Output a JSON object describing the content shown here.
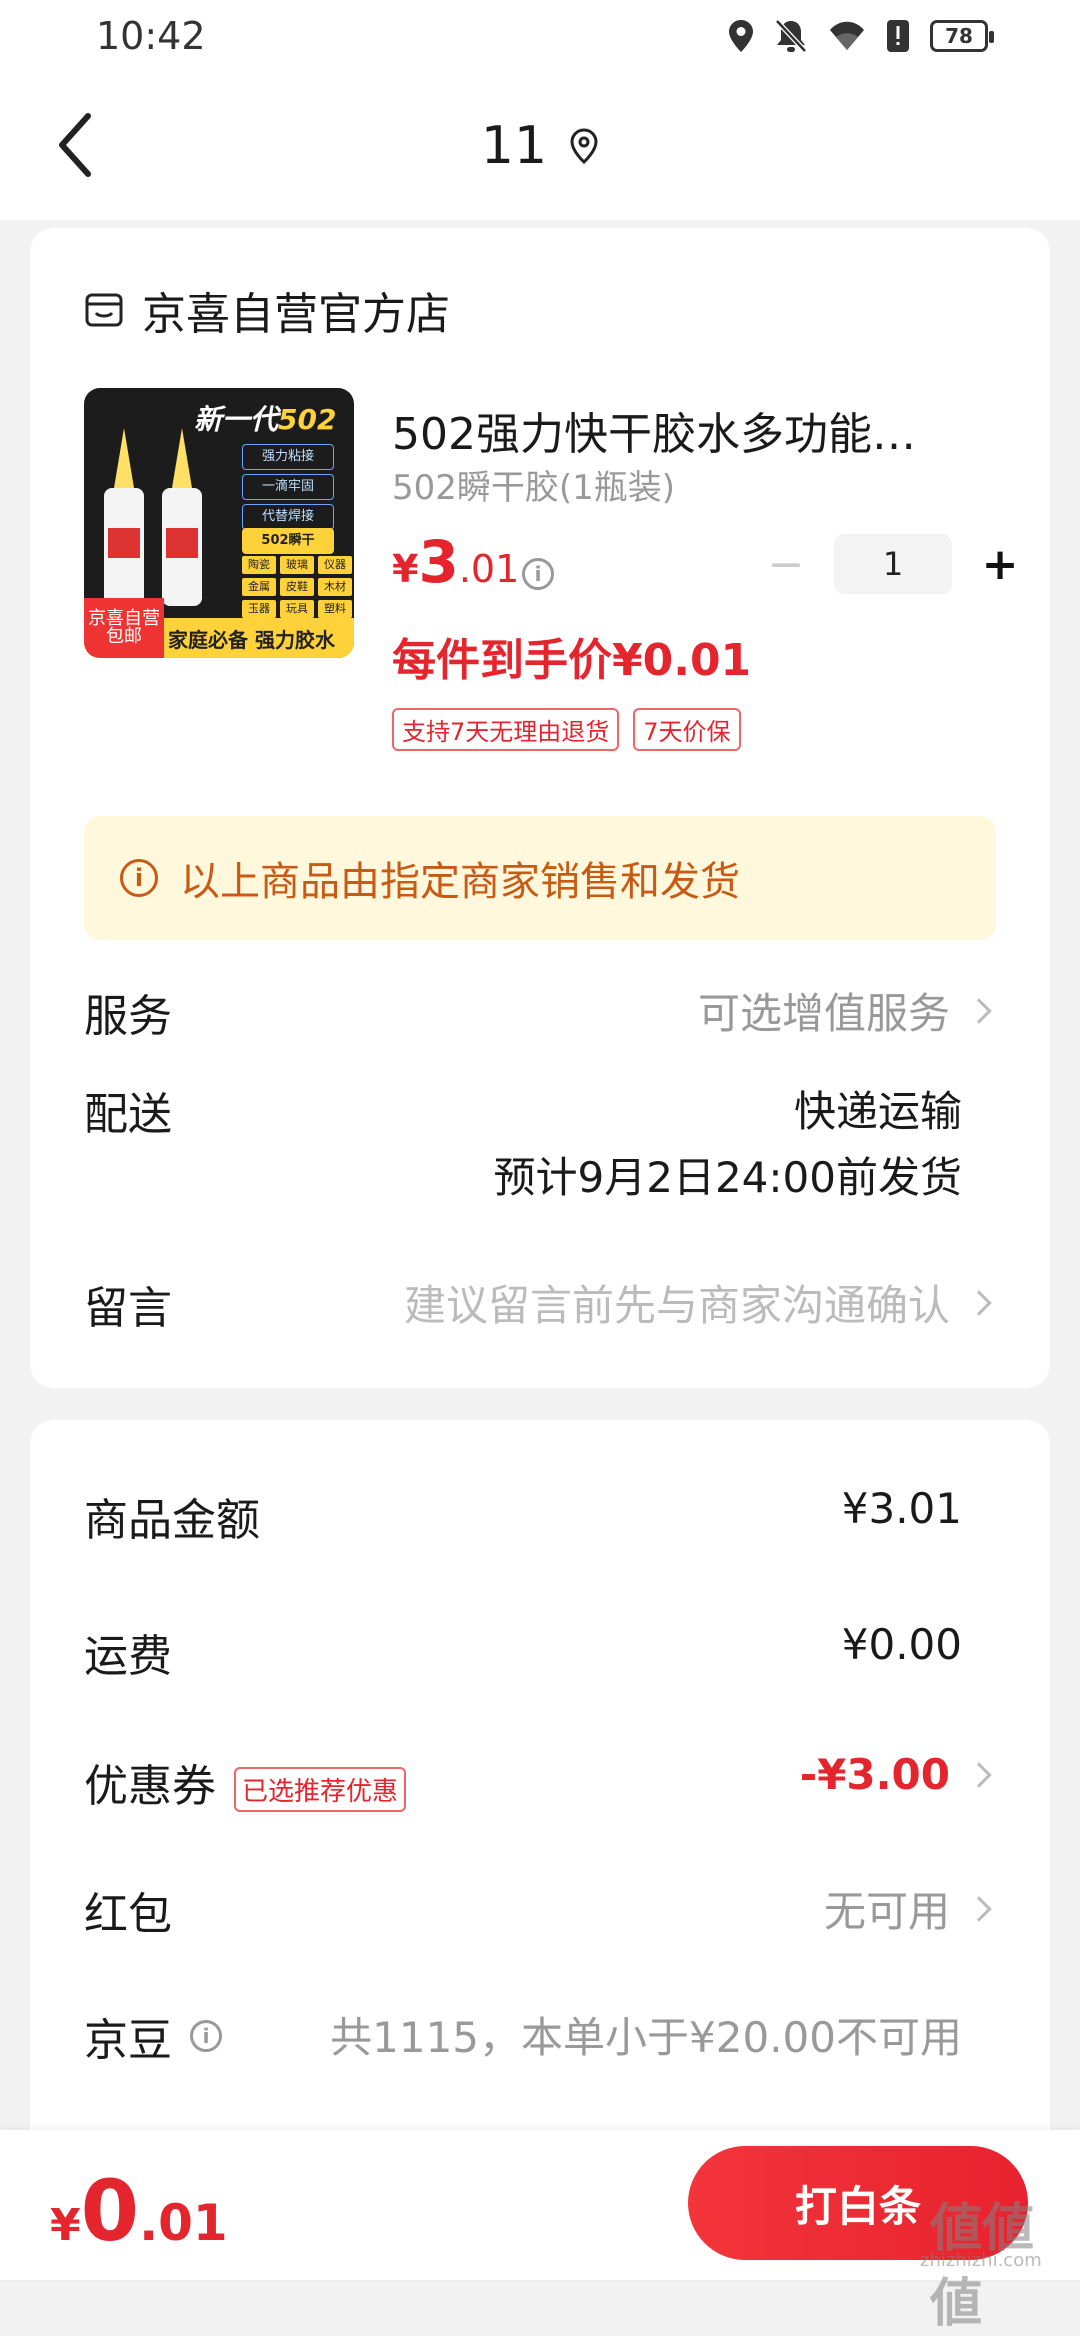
{
  "status": {
    "time": "10:42",
    "battery": "78"
  },
  "nav": {
    "title": "11"
  },
  "shop": {
    "name": "京喜自营官方店"
  },
  "product": {
    "image": {
      "top_text_a": "新一代",
      "top_text_b": "502",
      "features": [
        "强力粘接",
        "一滴牢固",
        "代替焊接"
      ],
      "highlight": "502瞬干",
      "grid": [
        "陶瓷",
        "玻璃",
        "仪器",
        "金属",
        "皮鞋",
        "木材",
        "玉器",
        "玩具",
        "塑料"
      ],
      "tag_a": "京喜自营",
      "tag_b": "包邮",
      "slogan": "家庭必备 强力胶水"
    },
    "title": "502强力快干胶水多功能…",
    "spec": "502瞬干胶(1瓶装)",
    "price_currency": "¥",
    "price_int": "3",
    "price_dec": ".01",
    "quantity": "1",
    "final_price": "每件到手价¥0.01",
    "badges": [
      "支持7天无理由退货",
      "7天价保"
    ]
  },
  "notice": {
    "text": "以上商品由指定商家销售和发货"
  },
  "rows": {
    "service": {
      "label": "服务",
      "value": "可选增值服务"
    },
    "delivery": {
      "label": "配送",
      "method": "快递运输",
      "eta": "预计9月2日24:00前发货"
    },
    "message": {
      "label": "留言",
      "placeholder": "建议留言前先与商家沟通确认"
    }
  },
  "summary": {
    "goods": {
      "label": "商品金额",
      "value": "¥3.01"
    },
    "shipping": {
      "label": "运费",
      "value": "¥0.00"
    },
    "coupon": {
      "label": "优惠券",
      "tag": "已选推荐优惠",
      "value": "-¥3.00"
    },
    "redpacket": {
      "label": "红包",
      "value": "无可用"
    },
    "jingdou": {
      "label": "京豆",
      "value": "共1115，本单小于¥20.00不可用"
    }
  },
  "bottom": {
    "currency": "¥",
    "total_int": "0",
    "total_dec": ".01",
    "pay_label": "打白条"
  },
  "watermark": {
    "main": "値値値",
    "sub": "zhizhizhi.com"
  },
  "colors": {
    "accent": "#e5252e",
    "notice_bg": "#fff8dc",
    "notice_text": "#c85a14"
  }
}
